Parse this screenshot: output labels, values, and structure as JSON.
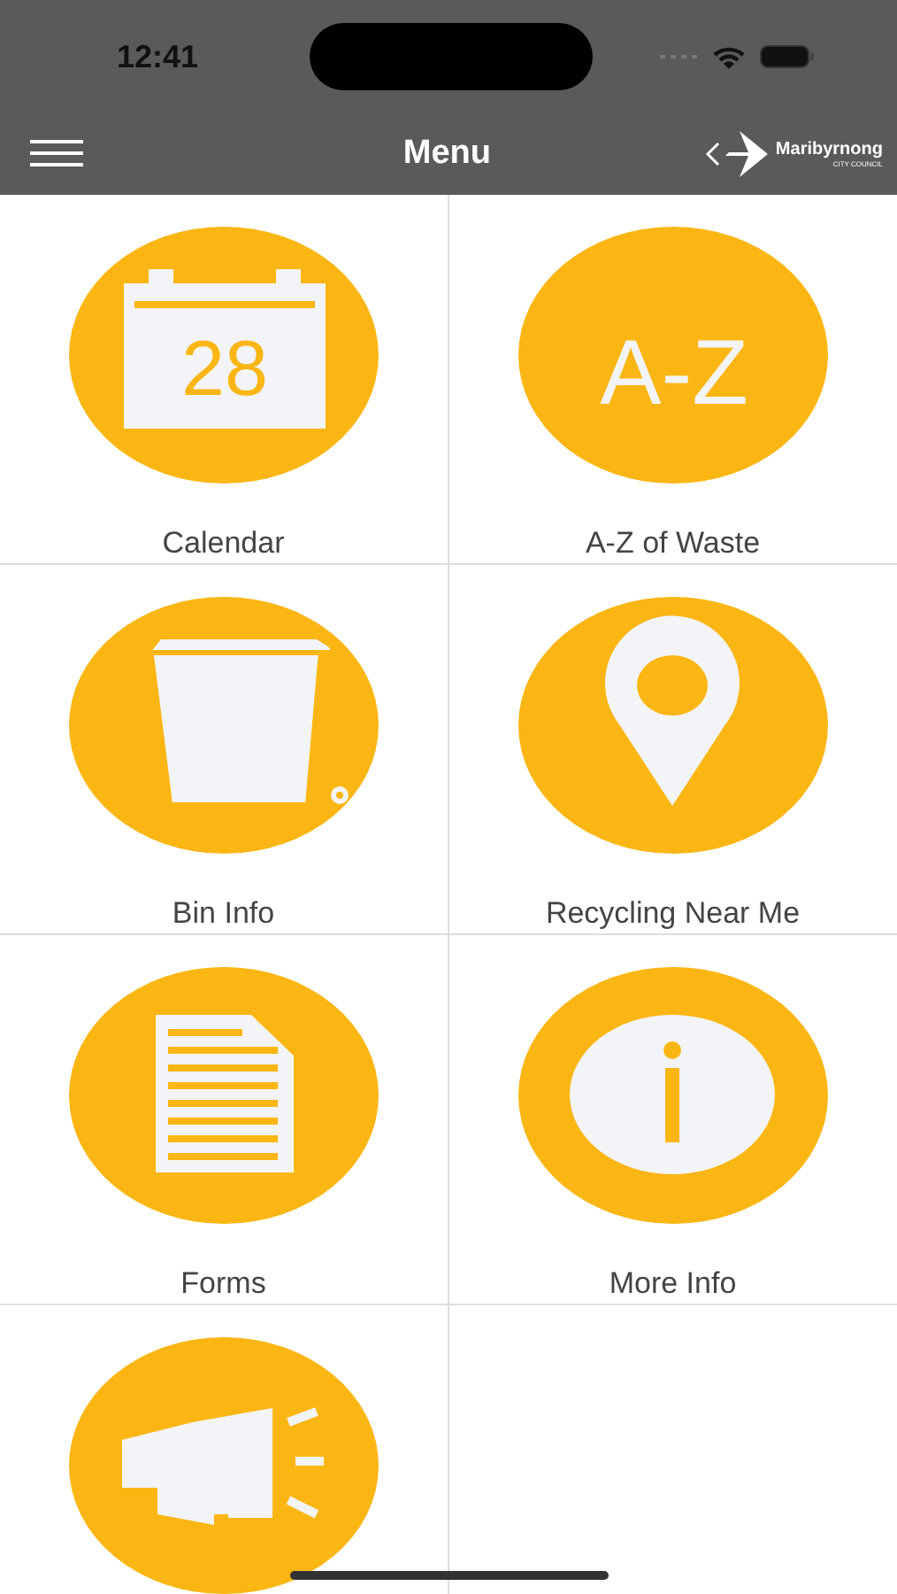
{
  "status_bar": {
    "time": "12:41"
  },
  "header": {
    "title": "Menu",
    "logo": {
      "name": "Maribyrnong",
      "subtitle": "CITY COUNCIL"
    }
  },
  "menu_items": [
    {
      "kind": "calendar",
      "label": "Calendar",
      "icon_text": "28"
    },
    {
      "kind": "az",
      "label": "A-Z of Waste",
      "icon_text": "A-Z"
    },
    {
      "kind": "bin",
      "label": "Bin Info"
    },
    {
      "kind": "pin",
      "label": "Recycling Near Me"
    },
    {
      "kind": "forms",
      "label": "Forms"
    },
    {
      "kind": "info",
      "label": "More Info"
    },
    {
      "kind": "megaphone"
    }
  ]
}
